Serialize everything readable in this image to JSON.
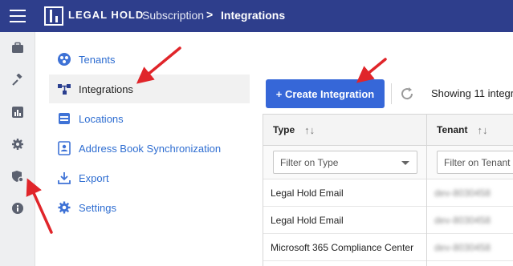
{
  "header": {
    "brand": "LEGAL HOLD",
    "breadcrumb_parent": "Subscription",
    "breadcrumb_separator": ">",
    "breadcrumb_current": "Integrations"
  },
  "rail": {
    "icons": [
      "briefcase-icon",
      "gavel-icon",
      "bar-chart-icon",
      "gear-icon",
      "shield-gear-icon",
      "info-icon"
    ]
  },
  "subnav": {
    "items": [
      {
        "label": "Tenants",
        "icon": "tenants-icon",
        "active": false
      },
      {
        "label": "Integrations",
        "icon": "integrations-icon",
        "active": true
      },
      {
        "label": "Locations",
        "icon": "locations-icon",
        "active": false
      },
      {
        "label": "Address Book Synchronization",
        "icon": "address-book-icon",
        "active": false
      },
      {
        "label": "Export",
        "icon": "export-icon",
        "active": false
      },
      {
        "label": "Settings",
        "icon": "settings-icon",
        "active": false
      }
    ]
  },
  "toolbar": {
    "create_label": "+ Create Integration",
    "showing_text": "Showing 11 integr"
  },
  "table": {
    "columns": [
      {
        "label": "Type",
        "filter_placeholder": "Filter on Type"
      },
      {
        "label": "Tenant",
        "filter_placeholder": "Filter on Tenant"
      }
    ],
    "rows": [
      {
        "type": "Legal Hold Email",
        "tenant": "dev-8030458"
      },
      {
        "type": "Legal Hold Email",
        "tenant": "dev-8030458"
      },
      {
        "type": "Microsoft 365 Compliance Center",
        "tenant": "dev-8030458"
      }
    ]
  },
  "colors": {
    "topbar": "#2e3e8c",
    "accent": "#3667d8",
    "link": "#2e6dd1",
    "annotation": "#e0252a"
  }
}
